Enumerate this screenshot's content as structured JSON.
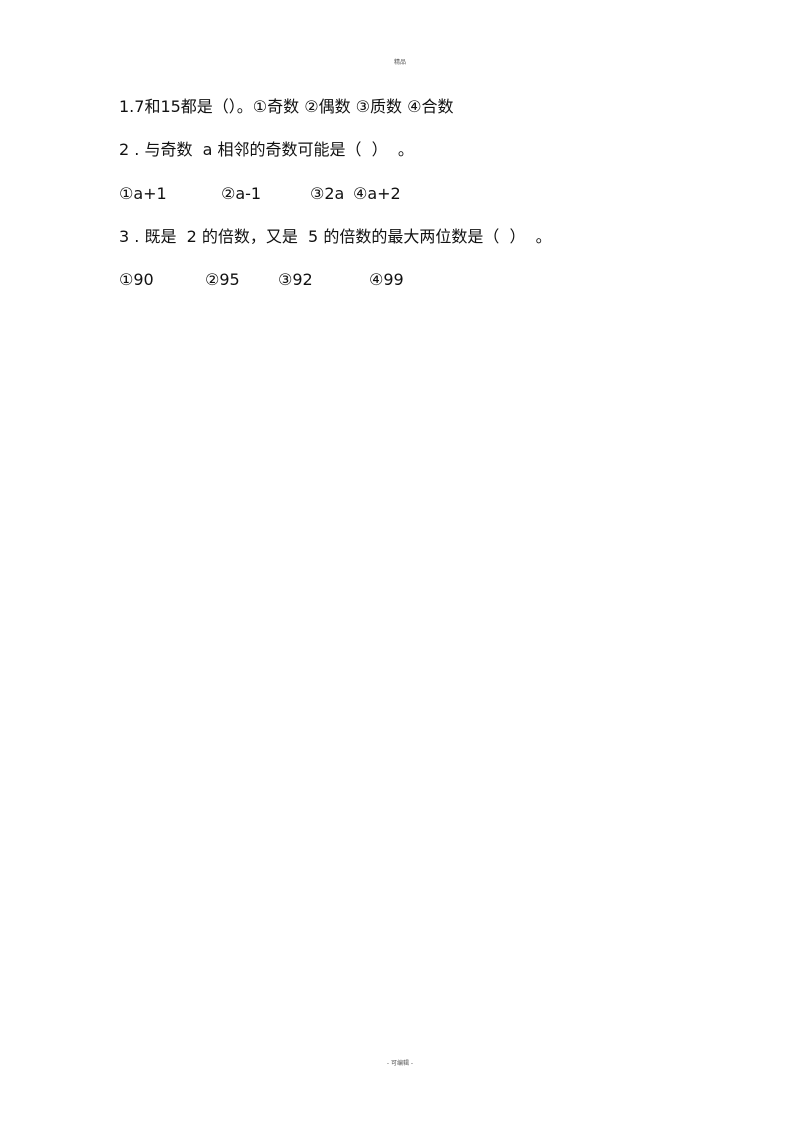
{
  "header": "精品",
  "footer": "- 可编辑 -",
  "questions": [
    {
      "text": "1.7和15都是（）。①奇数 ②偶数 ③质数 ④合数"
    },
    {
      "text": "2 . 与奇数  a 相邻的奇数可能是（  ）  。",
      "options": [
        "①a+1",
        "②a-1",
        "③2a",
        "④a+2"
      ]
    },
    {
      "text": "3 . 既是  2 的倍数，又是  5 的倍数的最大两位数是（  ）  。",
      "options": [
        "①90",
        "②95",
        "③92",
        "④99"
      ]
    }
  ]
}
